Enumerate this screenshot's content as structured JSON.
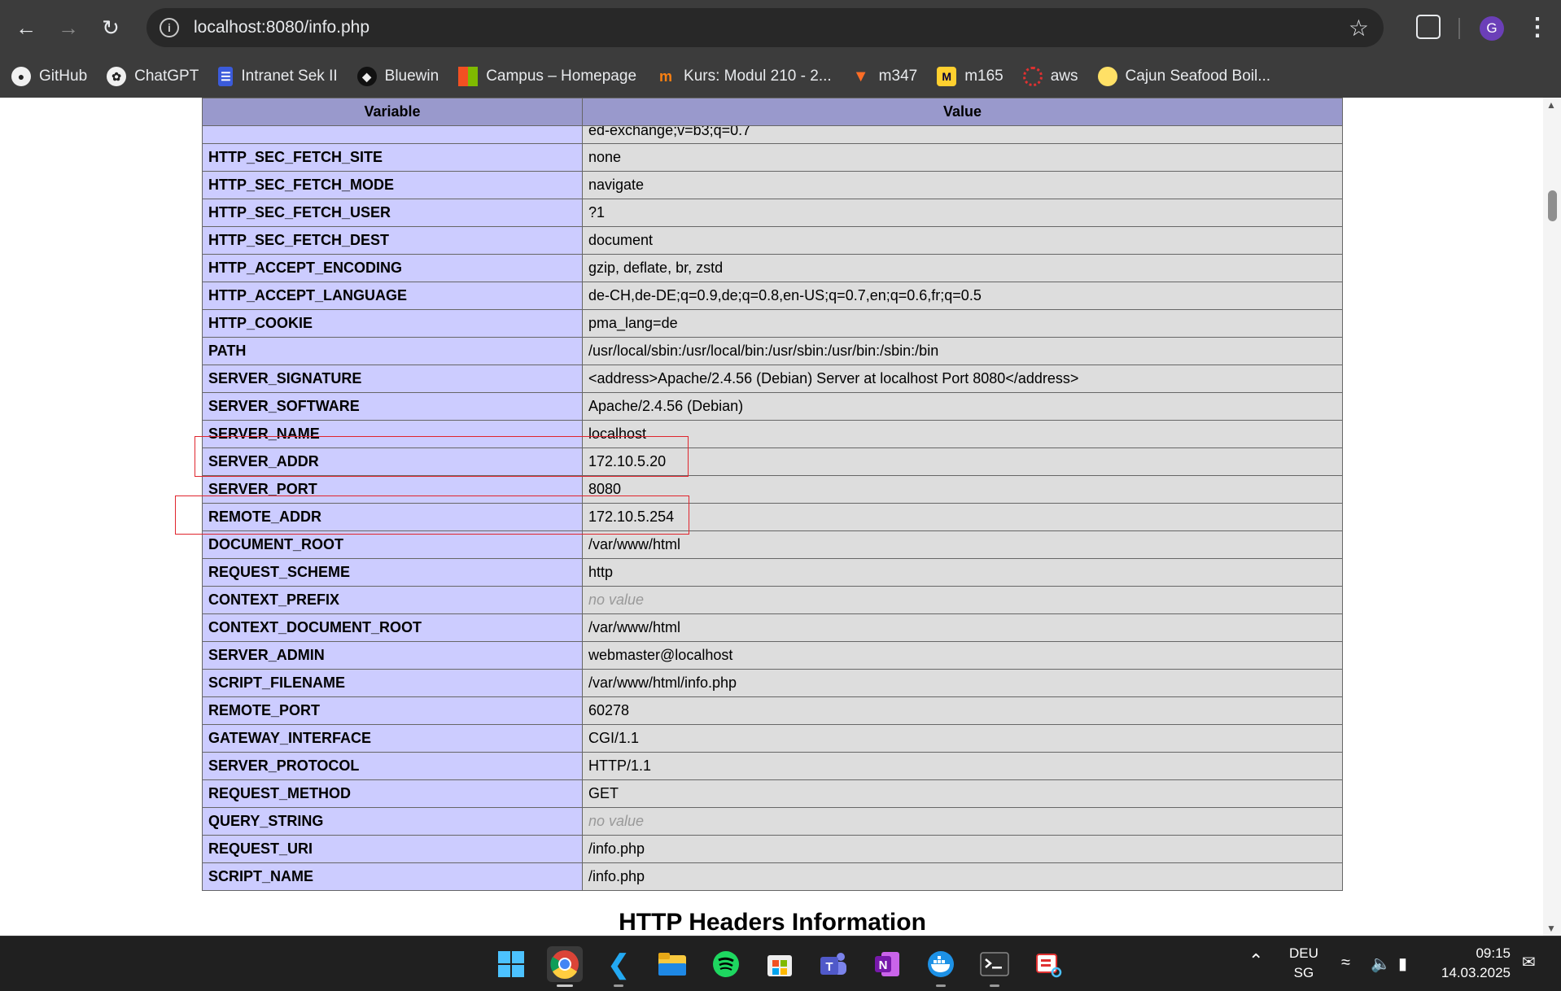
{
  "browser": {
    "url": "localhost:8080/info.php",
    "bookmarks": [
      {
        "label": "GitHub",
        "icon": "github-icon"
      },
      {
        "label": "ChatGPT",
        "icon": "chatgpt-icon"
      },
      {
        "label": "Intranet Sek II",
        "icon": "intranet-icon"
      },
      {
        "label": "Bluewin",
        "icon": "bluewin-icon"
      },
      {
        "label": "Campus – Homepage",
        "icon": "microsoft-icon"
      },
      {
        "label": "Kurs: Modul 210 - 2...",
        "icon": "moodle-icon"
      },
      {
        "label": "m347",
        "icon": "gitlab-icon"
      },
      {
        "label": "m165",
        "icon": "miro-icon"
      },
      {
        "label": "aws",
        "icon": "aws-icon"
      },
      {
        "label": "Cajun Seafood Boil...",
        "icon": "lemon-icon"
      }
    ],
    "profile_initial": "G"
  },
  "table": {
    "header_variable": "Variable",
    "header_value": "Value",
    "partial_value": "ed-exchange;v=b3;q=0.7",
    "rows": [
      {
        "name": "HTTP_SEC_FETCH_SITE",
        "value": "none"
      },
      {
        "name": "HTTP_SEC_FETCH_MODE",
        "value": "navigate"
      },
      {
        "name": "HTTP_SEC_FETCH_USER",
        "value": "?1"
      },
      {
        "name": "HTTP_SEC_FETCH_DEST",
        "value": "document"
      },
      {
        "name": "HTTP_ACCEPT_ENCODING",
        "value": "gzip, deflate, br, zstd"
      },
      {
        "name": "HTTP_ACCEPT_LANGUAGE",
        "value": "de-CH,de-DE;q=0.9,de;q=0.8,en-US;q=0.7,en;q=0.6,fr;q=0.5"
      },
      {
        "name": "HTTP_COOKIE",
        "value": "pma_lang=de"
      },
      {
        "name": "PATH",
        "value": "/usr/local/sbin:/usr/local/bin:/usr/sbin:/usr/bin:/sbin:/bin"
      },
      {
        "name": "SERVER_SIGNATURE",
        "value": "<address>Apache/2.4.56 (Debian) Server at localhost Port 8080</address>"
      },
      {
        "name": "SERVER_SOFTWARE",
        "value": "Apache/2.4.56 (Debian)"
      },
      {
        "name": "SERVER_NAME",
        "value": "localhost"
      },
      {
        "name": "SERVER_ADDR",
        "value": "172.10.5.20"
      },
      {
        "name": "SERVER_PORT",
        "value": "8080"
      },
      {
        "name": "REMOTE_ADDR",
        "value": "172.10.5.254"
      },
      {
        "name": "DOCUMENT_ROOT",
        "value": "/var/www/html"
      },
      {
        "name": "REQUEST_SCHEME",
        "value": "http"
      },
      {
        "name": "CONTEXT_PREFIX",
        "value": "no value",
        "novalue": true
      },
      {
        "name": "CONTEXT_DOCUMENT_ROOT",
        "value": "/var/www/html"
      },
      {
        "name": "SERVER_ADMIN",
        "value": "webmaster@localhost"
      },
      {
        "name": "SCRIPT_FILENAME",
        "value": "/var/www/html/info.php"
      },
      {
        "name": "REMOTE_PORT",
        "value": "60278"
      },
      {
        "name": "GATEWAY_INTERFACE",
        "value": "CGI/1.1"
      },
      {
        "name": "SERVER_PROTOCOL",
        "value": "HTTP/1.1"
      },
      {
        "name": "REQUEST_METHOD",
        "value": "GET"
      },
      {
        "name": "QUERY_STRING",
        "value": "no value",
        "novalue": true
      },
      {
        "name": "REQUEST_URI",
        "value": "/info.php"
      },
      {
        "name": "SCRIPT_NAME",
        "value": "/info.php"
      }
    ]
  },
  "section_title": "HTTP Headers Information",
  "colors": {
    "header_bg": "#9999cc",
    "name_cell_bg": "#ccccff",
    "value_cell_bg": "#dddddd",
    "highlight": "#e0252d"
  },
  "taskbar": {
    "apps": [
      "windows-start-icon",
      "chrome-icon",
      "vscode-icon",
      "file-explorer-icon",
      "spotify-icon",
      "microsoft-store-icon",
      "teams-icon",
      "onenote-icon",
      "docker-icon",
      "terminal-icon",
      "snipping-tool-icon"
    ],
    "language_line1": "DEU",
    "language_line2": "SG",
    "time": "09:15",
    "date": "14.03.2025"
  }
}
